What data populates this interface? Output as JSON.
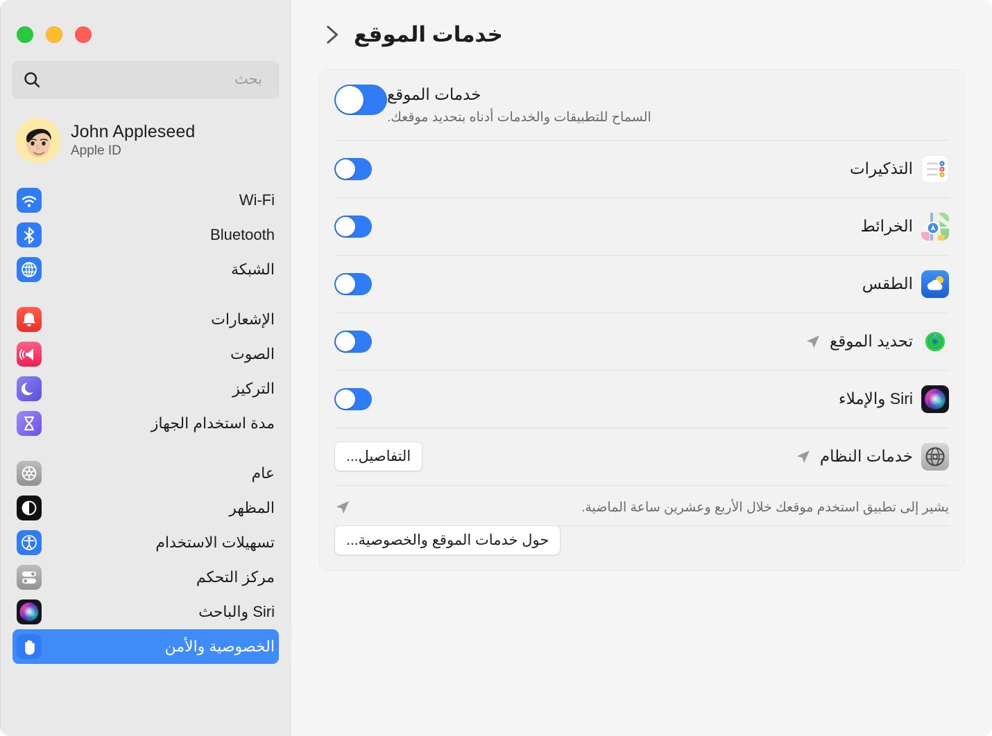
{
  "window": {
    "traffic_lights": [
      {
        "name": "close",
        "color": "#ff5f57"
      },
      {
        "name": "minimize",
        "color": "#febc2e"
      },
      {
        "name": "zoom",
        "color": "#28c840"
      }
    ]
  },
  "sidebar": {
    "search": {
      "placeholder": "بحث",
      "value": "",
      "icon": "search-icon"
    },
    "account": {
      "name": "John Appleseed",
      "subtitle": "Apple ID",
      "avatar": "memoji-avatar"
    },
    "groups": [
      {
        "items": [
          {
            "label": "Wi-Fi",
            "icon": "wifi-icon",
            "selected": false
          },
          {
            "label": "Bluetooth",
            "icon": "bluetooth-icon",
            "selected": false
          },
          {
            "label": "الشبكة",
            "icon": "network-globe-icon",
            "selected": false
          }
        ]
      },
      {
        "items": [
          {
            "label": "الإشعارات",
            "icon": "notifications-bell-icon",
            "selected": false
          },
          {
            "label": "الصوت",
            "icon": "sound-speaker-icon",
            "selected": false
          },
          {
            "label": "التركيز",
            "icon": "focus-moon-icon",
            "selected": false
          },
          {
            "label": "مدة استخدام الجهاز",
            "icon": "screen-time-hourglass-icon",
            "selected": false
          }
        ]
      },
      {
        "items": [
          {
            "label": "عام",
            "icon": "general-gear-icon",
            "selected": false
          },
          {
            "label": "المظهر",
            "icon": "appearance-contrast-icon",
            "selected": false
          },
          {
            "label": "تسهيلات الاستخدام",
            "icon": "accessibility-icon",
            "selected": false
          },
          {
            "label": "مركز التحكم",
            "icon": "control-center-icon",
            "selected": false
          },
          {
            "label": "Siri والباحث",
            "icon": "siri-orb-icon",
            "selected": false
          },
          {
            "label": "الخصوصية والأمن",
            "icon": "privacy-hand-icon",
            "selected": true
          }
        ]
      }
    ]
  },
  "content": {
    "back_icon": "chevron-right-icon",
    "title": "خدمات الموقع",
    "master": {
      "title": "خدمات الموقع",
      "subtitle": "السماح للتطبيقات والخدمات أدناه بتحديد موقعك.",
      "toggle_on": true
    },
    "apps": [
      {
        "name": "التذكيرات",
        "icon": "reminders-icon",
        "toggle_on": true,
        "recent_location": false
      },
      {
        "name": "الخرائط",
        "icon": "maps-icon",
        "toggle_on": true,
        "recent_location": false
      },
      {
        "name": "الطقس",
        "icon": "weather-icon",
        "toggle_on": true,
        "recent_location": false
      },
      {
        "name": "تحديد الموقع",
        "icon": "findmy-icon",
        "toggle_on": true,
        "recent_location": true
      },
      {
        "name": "Siri والإملاء",
        "icon": "siri-orb-icon",
        "toggle_on": true,
        "recent_location": false
      }
    ],
    "system_services": {
      "name": "خدمات النظام",
      "icon": "system-services-icon",
      "recent_location": true,
      "details_button": "التفاصيل..."
    },
    "note": {
      "icon": "location-arrow-icon",
      "text": "يشير إلى تطبيق استخدم موقعك خلال الأربع وعشرين ساعة الماضية."
    },
    "about_button": "حول خدمات الموقع والخصوصية..."
  },
  "colors": {
    "accent": "#3f8cf8",
    "toggle_on": "#2f7cf6",
    "sidebar_bg": "#e9e9e9",
    "content_bg": "#f5f5f5",
    "card_bg": "#f2f2f2"
  }
}
